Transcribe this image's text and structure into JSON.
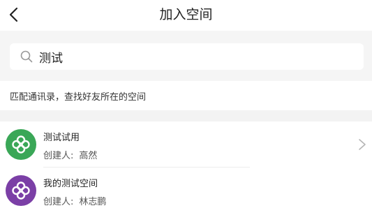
{
  "header": {
    "title": "加入空间",
    "back_icon": "chevron-left-icon"
  },
  "search": {
    "value": "测试",
    "icon": "search-icon"
  },
  "hint": {
    "text": "匹配通讯录，查找好友所在的空间"
  },
  "results": [
    {
      "name": "测试试用",
      "creator_label": "创建人:",
      "creator": "高然",
      "avatar_color": "#3aa757",
      "show_chevron": true
    },
    {
      "name": "我的测试空间",
      "creator_label": "创建人:",
      "creator": "林志鹏",
      "avatar_color": "#7b3fa6",
      "show_chevron": false
    }
  ],
  "colors": {
    "background_band": "#f5f5f5",
    "text": "#222222",
    "secondary_text": "#555555"
  }
}
